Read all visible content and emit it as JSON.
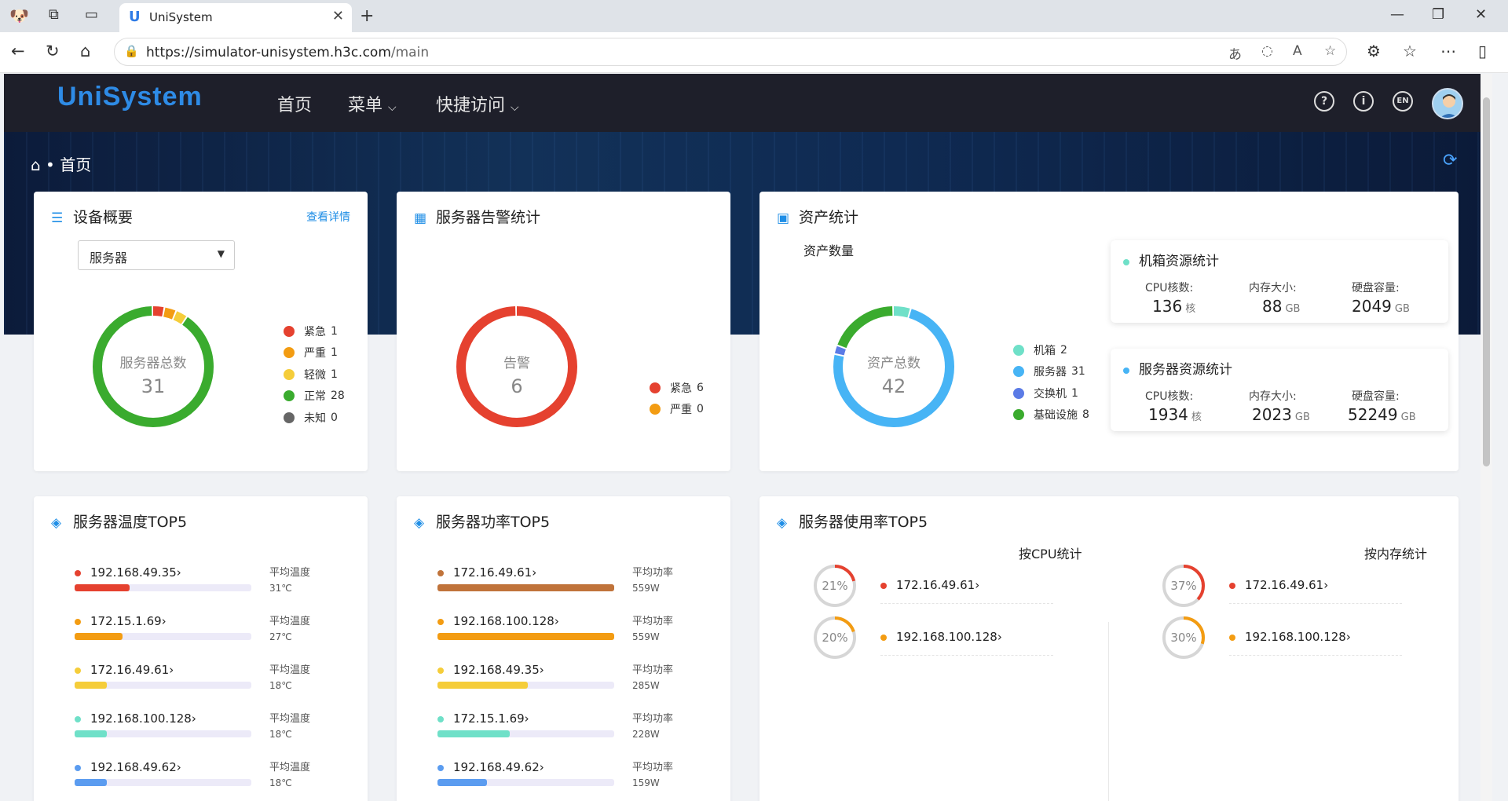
{
  "browser": {
    "tab_title": "UniSystem",
    "url_host": "https://simulator-unisystem.h3c.com",
    "url_path": "/main"
  },
  "header": {
    "logo": "UniSystem",
    "nav": [
      "首页",
      "菜单",
      "快捷访问"
    ],
    "lang": "EN"
  },
  "breadcrumb": {
    "home": "首页"
  },
  "device_overview": {
    "title": "设备概要",
    "more": "查看详情",
    "select": "服务器",
    "center_label": "服务器总数",
    "total": "31",
    "legend": [
      {
        "label": "紧急",
        "value": "1",
        "color": "#e5412f"
      },
      {
        "label": "严重",
        "value": "1",
        "color": "#f39c12"
      },
      {
        "label": "轻微",
        "value": "1",
        "color": "#f5cd3a"
      },
      {
        "label": "正常",
        "value": "28",
        "color": "#3aab2e"
      },
      {
        "label": "未知",
        "value": "0",
        "color": "#666666"
      }
    ]
  },
  "alarm_stats": {
    "title": "服务器告警统计",
    "center_label": "告警",
    "total": "6",
    "legend": [
      {
        "label": "紧急",
        "value": "6",
        "color": "#e5412f"
      },
      {
        "label": "严重",
        "value": "0",
        "color": "#f39c12"
      }
    ]
  },
  "asset_stats": {
    "title": "资产统计",
    "subtitle": "资产数量",
    "center_label": "资产总数",
    "total": "42",
    "legend": [
      {
        "label": "机箱",
        "value": "2",
        "color": "#6fe0c8"
      },
      {
        "label": "服务器",
        "value": "31",
        "color": "#47b4f5"
      },
      {
        "label": "交换机",
        "value": "1",
        "color": "#5b7be6"
      },
      {
        "label": "基础设施",
        "value": "8",
        "color": "#3aab2e"
      }
    ],
    "chassis": {
      "title": "机箱资源统计",
      "cpu_label": "CPU核数:",
      "cpu": "136",
      "cpu_unit": "核",
      "mem_label": "内存大小:",
      "mem": "88",
      "mem_unit": "GB",
      "disk_label": "硬盘容量:",
      "disk": "2049",
      "disk_unit": "GB"
    },
    "server": {
      "title": "服务器资源统计",
      "cpu_label": "CPU核数:",
      "cpu": "1934",
      "cpu_unit": "核",
      "mem_label": "内存大小:",
      "mem": "2023",
      "mem_unit": "GB",
      "disk_label": "硬盘容量:",
      "disk": "52249",
      "disk_unit": "GB"
    }
  },
  "temp_top5": {
    "title": "服务器温度TOP5",
    "label": "平均温度",
    "rows": [
      {
        "ip": "192.168.49.35",
        "value": "31℃",
        "frac": 0.31,
        "color": "#e5412f"
      },
      {
        "ip": "172.15.1.69",
        "value": "27℃",
        "frac": 0.27,
        "color": "#f39c12"
      },
      {
        "ip": "172.16.49.61",
        "value": "18℃",
        "frac": 0.18,
        "color": "#f5cd3a"
      },
      {
        "ip": "192.168.100.128",
        "value": "18℃",
        "frac": 0.18,
        "color": "#6fe0c8"
      },
      {
        "ip": "192.168.49.62",
        "value": "18℃",
        "frac": 0.18,
        "color": "#5b9cf0"
      }
    ]
  },
  "power_top5": {
    "title": "服务器功率TOP5",
    "label": "平均功率",
    "rows": [
      {
        "ip": "172.16.49.61",
        "value": "559W",
        "frac": 1.0,
        "color": "#c0733a"
      },
      {
        "ip": "192.168.100.128",
        "value": "559W",
        "frac": 1.0,
        "color": "#f39c12"
      },
      {
        "ip": "192.168.49.35",
        "value": "285W",
        "frac": 0.51,
        "color": "#f5cd3a"
      },
      {
        "ip": "172.15.1.69",
        "value": "228W",
        "frac": 0.41,
        "color": "#6fe0c8"
      },
      {
        "ip": "192.168.49.62",
        "value": "159W",
        "frac": 0.28,
        "color": "#5b9cf0"
      }
    ]
  },
  "usage_top5": {
    "title": "服务器使用率TOP5",
    "cpu_title": "按CPU统计",
    "mem_title": "按内存统计",
    "cpu": [
      {
        "ip": "172.16.49.61",
        "pct": "21%",
        "frac": 0.21,
        "color": "#e5412f"
      },
      {
        "ip": "192.168.100.128",
        "pct": "20%",
        "frac": 0.2,
        "color": "#f39c12"
      }
    ],
    "mem": [
      {
        "ip": "172.16.49.61",
        "pct": "37%",
        "frac": 0.37,
        "color": "#e5412f"
      },
      {
        "ip": "192.168.100.128",
        "pct": "30%",
        "frac": 0.3,
        "color": "#f39c12"
      }
    ]
  }
}
